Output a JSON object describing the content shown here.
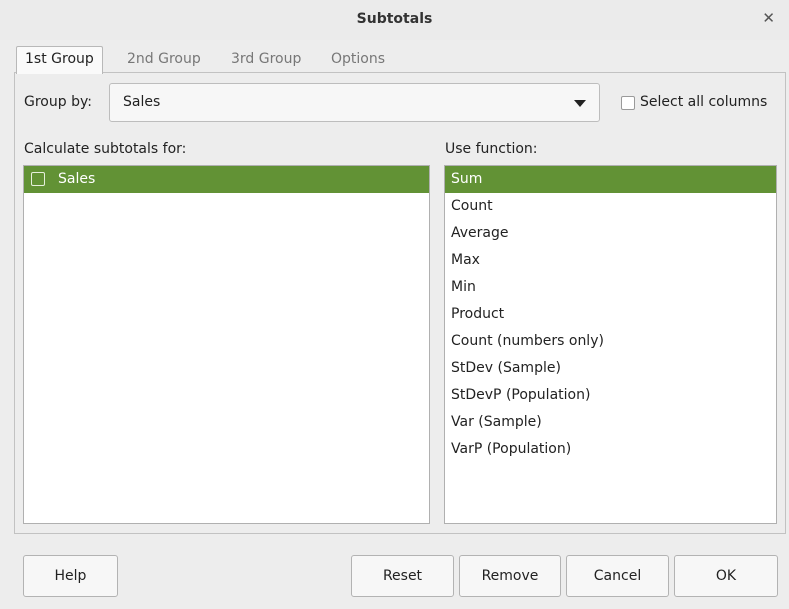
{
  "window": {
    "title": "Subtotals"
  },
  "tabs": [
    {
      "label": "1st Group",
      "active": true
    },
    {
      "label": "2nd Group",
      "active": false
    },
    {
      "label": "3rd Group",
      "active": false
    },
    {
      "label": "Options",
      "active": false
    }
  ],
  "group_by": {
    "label": "Group by:",
    "value": "Sales"
  },
  "select_all": {
    "label": "Select all columns",
    "checked": false
  },
  "subtotals_for": {
    "label": "Calculate subtotals for:",
    "items": [
      {
        "label": "Sales",
        "checked": false,
        "selected": true
      }
    ]
  },
  "use_function": {
    "label": "Use function:",
    "items": [
      "Sum",
      "Count",
      "Average",
      "Max",
      "Min",
      "Product",
      "Count (numbers only)",
      "StDev (Sample)",
      "StDevP (Population)",
      "Var (Sample)",
      "VarP (Population)"
    ],
    "selected": "Sum"
  },
  "buttons": {
    "help": "Help",
    "reset": "Reset",
    "remove": "Remove",
    "cancel": "Cancel",
    "ok": "OK"
  },
  "colors": {
    "selection": "#629235"
  }
}
